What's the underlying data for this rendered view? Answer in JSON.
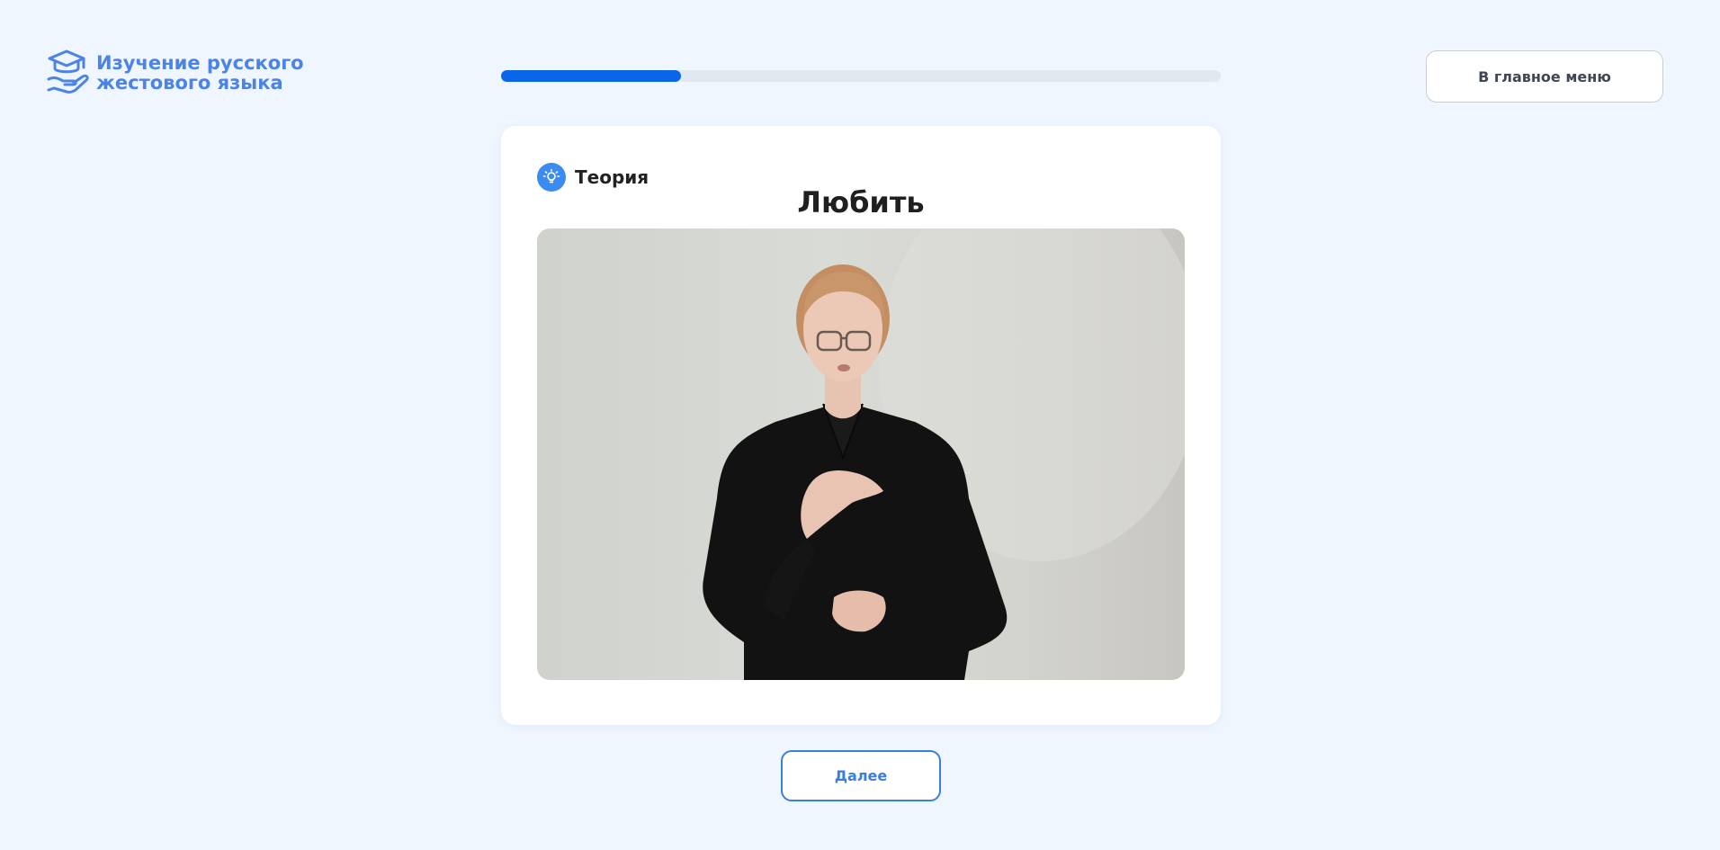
{
  "header": {
    "logo_icon": "graduation-cap-hand-icon",
    "logo_line1": "Изучение русского",
    "logo_line2": "жестового языка",
    "menu_button": "В главное меню"
  },
  "progress": {
    "value_percent": 25
  },
  "lesson": {
    "section_icon": "lightbulb-icon",
    "section_label": "Теория",
    "word": "Любить"
  },
  "video": {
    "subject": "sign-language-video"
  },
  "footer": {
    "next_button": "Далее"
  },
  "colors": {
    "accent": "#0a66e8",
    "logo": "#4b83e6",
    "background": "#eff6ff"
  }
}
